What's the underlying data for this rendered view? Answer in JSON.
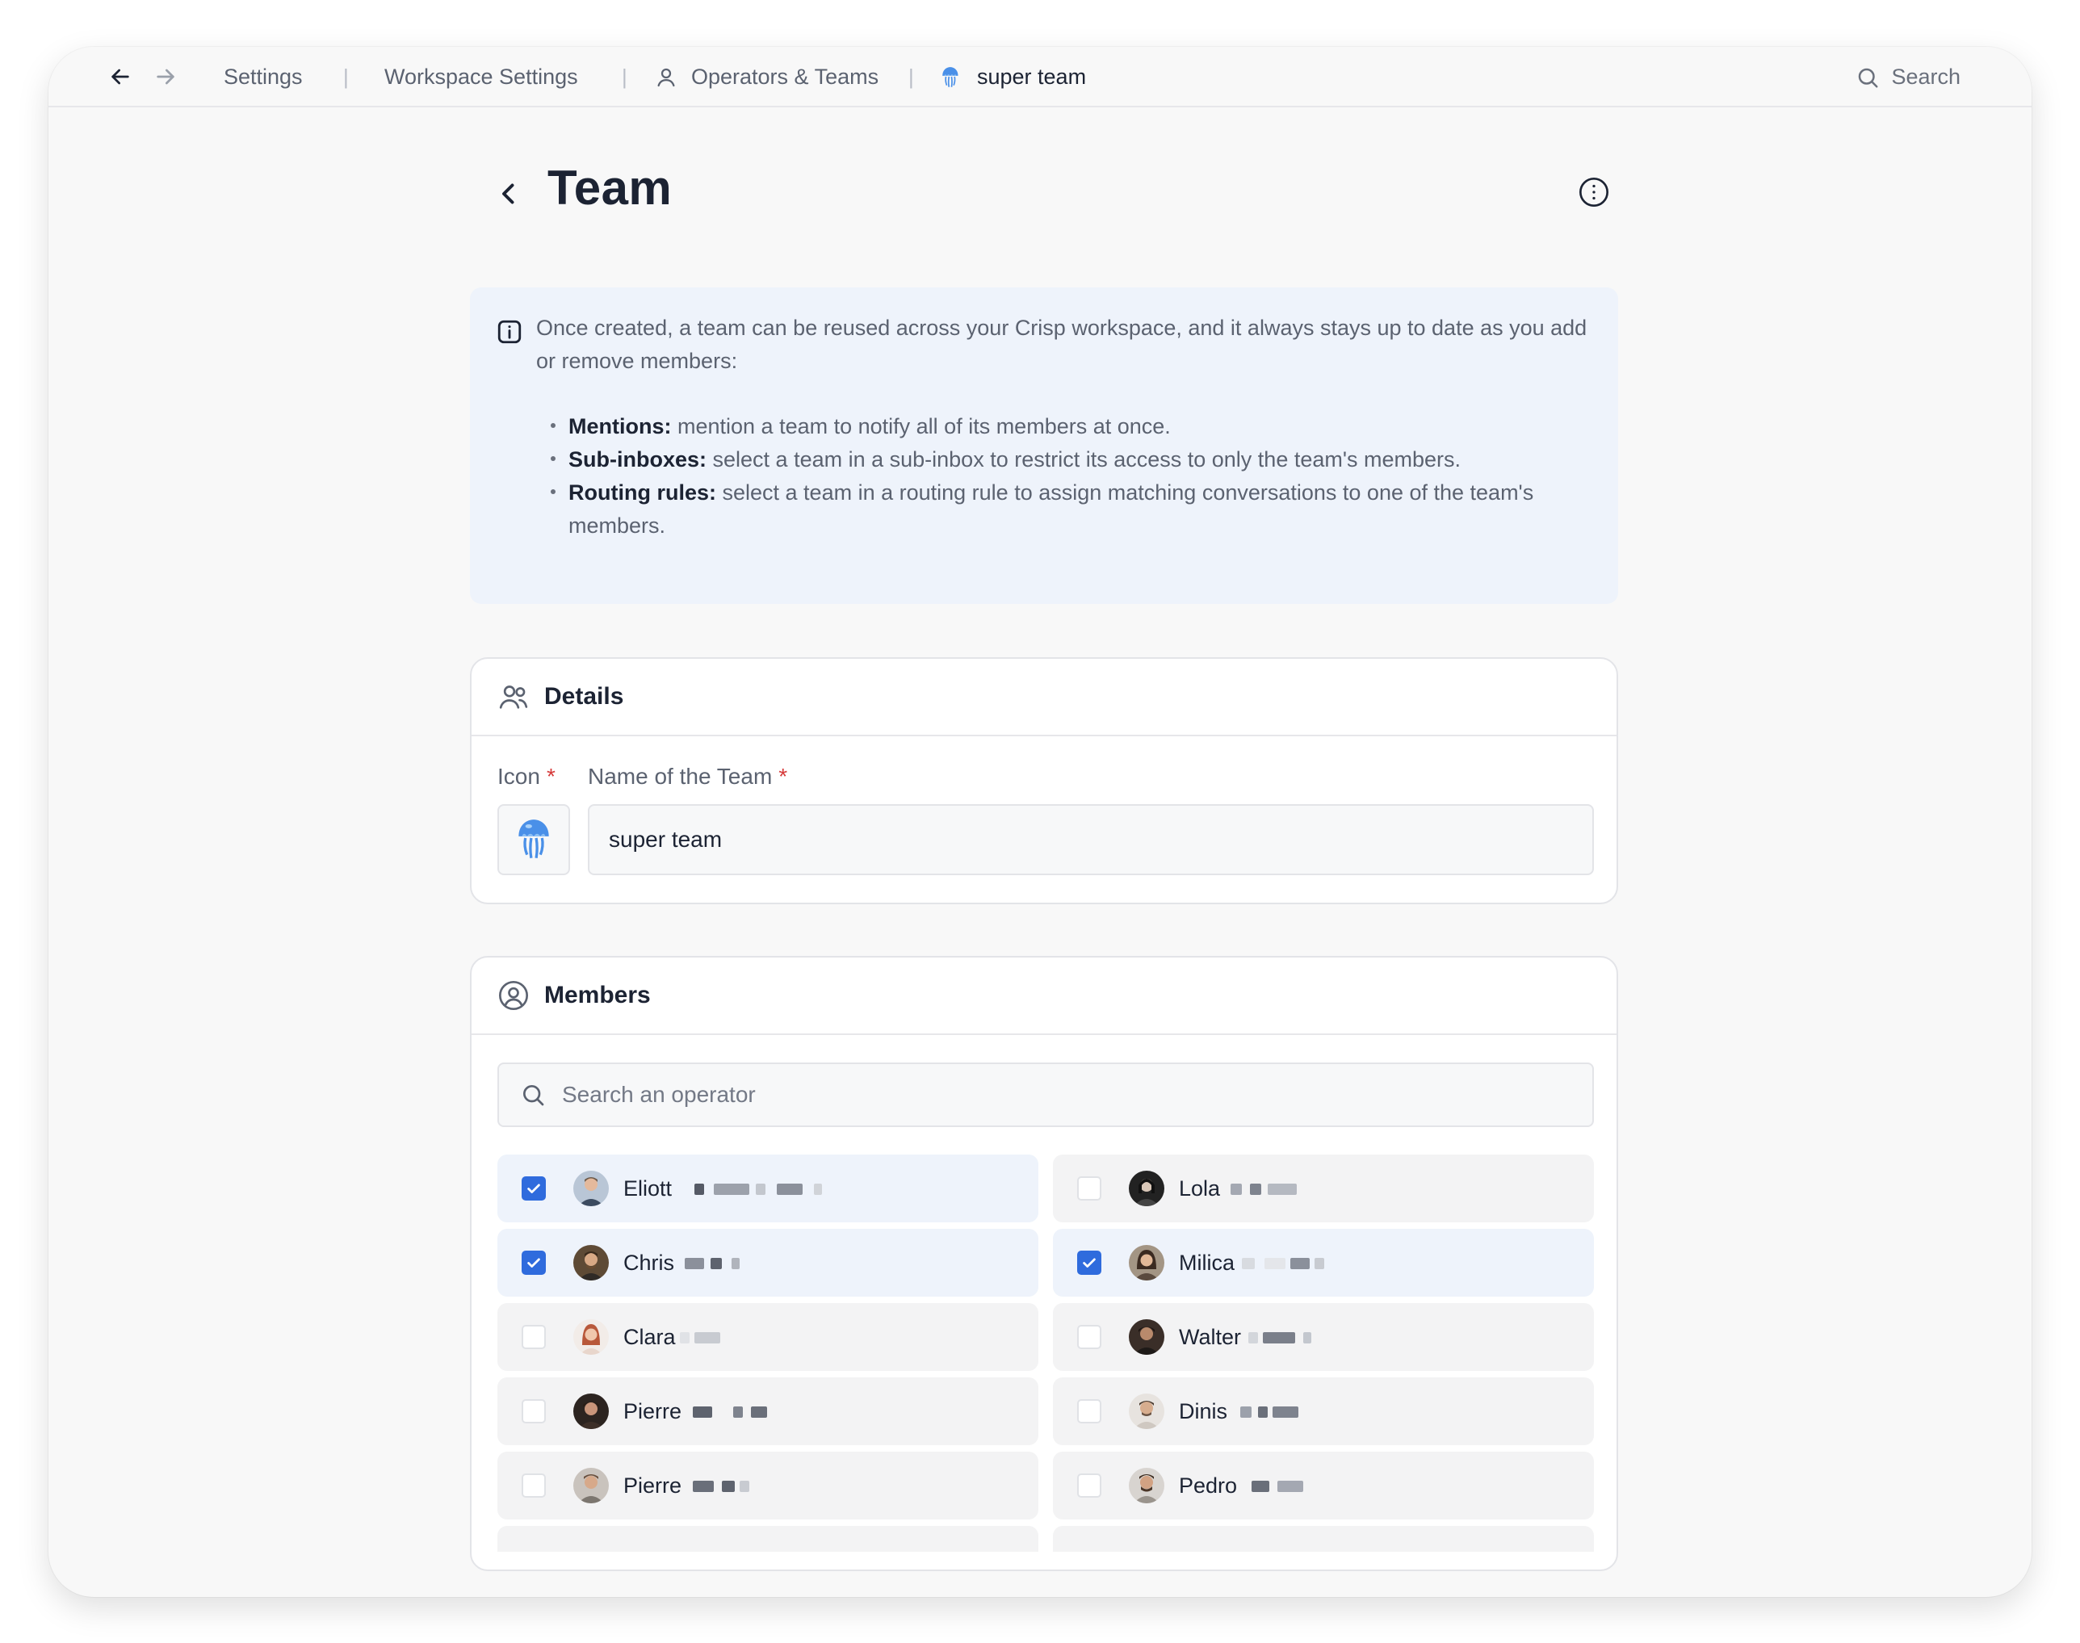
{
  "topbar": {
    "breadcrumbs": [
      "Settings",
      "Workspace Settings",
      "Operators & Teams",
      "super team"
    ],
    "separator": "|",
    "search_label": "Search"
  },
  "header": {
    "title": "Team"
  },
  "info": {
    "intro": "Once created, a team can be reused across your Crisp workspace, and it always stays up to date as you add or remove members:",
    "items": [
      {
        "term": "Mentions:",
        "text": " mention a team to notify all of its members at once."
      },
      {
        "term": "Sub-inboxes:",
        "text": " select a team in a sub-inbox to restrict its access to only the team's members."
      },
      {
        "term": "Routing rules:",
        "text": " select a team in a routing rule to assign matching conversations to one of the team's members."
      }
    ]
  },
  "details": {
    "title": "Details",
    "icon_label": "Icon",
    "name_label": "Name of the Team",
    "required_mark": "*",
    "team_icon": "jellyfish-icon",
    "team_name": "super team"
  },
  "members": {
    "title": "Members",
    "search_placeholder": "Search an operator",
    "list": [
      {
        "name": "Eliott",
        "checked": true
      },
      {
        "name": "Lola",
        "checked": false
      },
      {
        "name": "Chris",
        "checked": true
      },
      {
        "name": "Milica",
        "checked": true
      },
      {
        "name": "Clara",
        "checked": false
      },
      {
        "name": "Walter",
        "checked": false
      },
      {
        "name": "Pierre",
        "checked": false
      },
      {
        "name": "Dinis",
        "checked": false
      },
      {
        "name": "Pierre",
        "checked": false
      },
      {
        "name": "Pedro",
        "checked": false
      }
    ]
  },
  "colors": {
    "accent": "#2f6bdd",
    "required": "#d63a3a",
    "info_bg": "#eef3fb"
  }
}
